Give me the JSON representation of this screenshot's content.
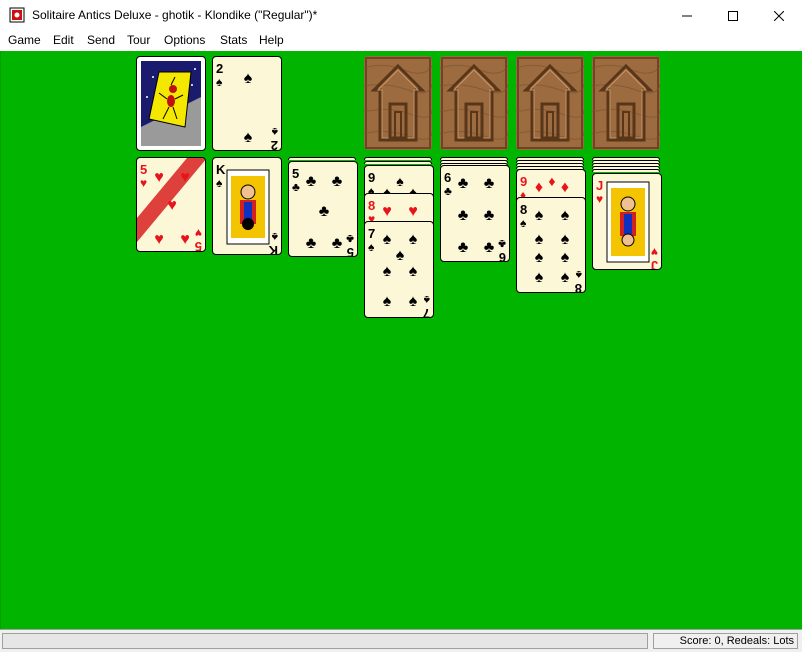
{
  "window": {
    "title": "Solitaire Antics Deluxe - ghotik - Klondike (\"Regular\")*"
  },
  "menu": [
    "Game",
    "Edit",
    "Send",
    "Tour",
    "Options",
    "Stats",
    "Help"
  ],
  "stock": {
    "card_back": "ant-card-back"
  },
  "waste": {
    "rank": "2",
    "suit": "spades",
    "symbol": "♠"
  },
  "foundations": [
    {
      "icon": "house-icon"
    },
    {
      "icon": "house-icon"
    },
    {
      "icon": "house-icon"
    },
    {
      "icon": "house-icon"
    }
  ],
  "tableau": [
    {
      "face_down": 0,
      "cards": [
        {
          "rank": "5",
          "symbol": "♥",
          "color": "red"
        }
      ]
    },
    {
      "face_down": 0,
      "cards": [
        {
          "rank": "K",
          "symbol": "♠",
          "color": "black"
        }
      ]
    },
    {
      "face_down": 1,
      "cards": [
        {
          "rank": "5",
          "symbol": "♣",
          "color": "black"
        }
      ]
    },
    {
      "face_down": 2,
      "cards": [
        {
          "rank": "9",
          "symbol": "♠",
          "color": "black"
        },
        {
          "rank": "8",
          "symbol": "♥",
          "color": "red"
        },
        {
          "rank": "7",
          "symbol": "♠",
          "color": "black"
        }
      ]
    },
    {
      "face_down": 3,
      "cards": [
        {
          "rank": "6",
          "symbol": "♣",
          "color": "black"
        }
      ]
    },
    {
      "face_down": 4,
      "cards": [
        {
          "rank": "9",
          "symbol": "♦",
          "color": "red"
        },
        {
          "rank": "8",
          "symbol": "♠",
          "color": "black"
        }
      ]
    },
    {
      "face_down": 5,
      "cards": [
        {
          "rank": "J",
          "symbol": "♥",
          "color": "red"
        }
      ]
    }
  ],
  "status": {
    "left": "",
    "right": "Score: 0, Redeals: Lots"
  },
  "colors": {
    "felt": "#00b400",
    "card_face": "#fcf7d6",
    "red_suit": "#e8141b",
    "foundation_wood": "#9c6b3f"
  }
}
